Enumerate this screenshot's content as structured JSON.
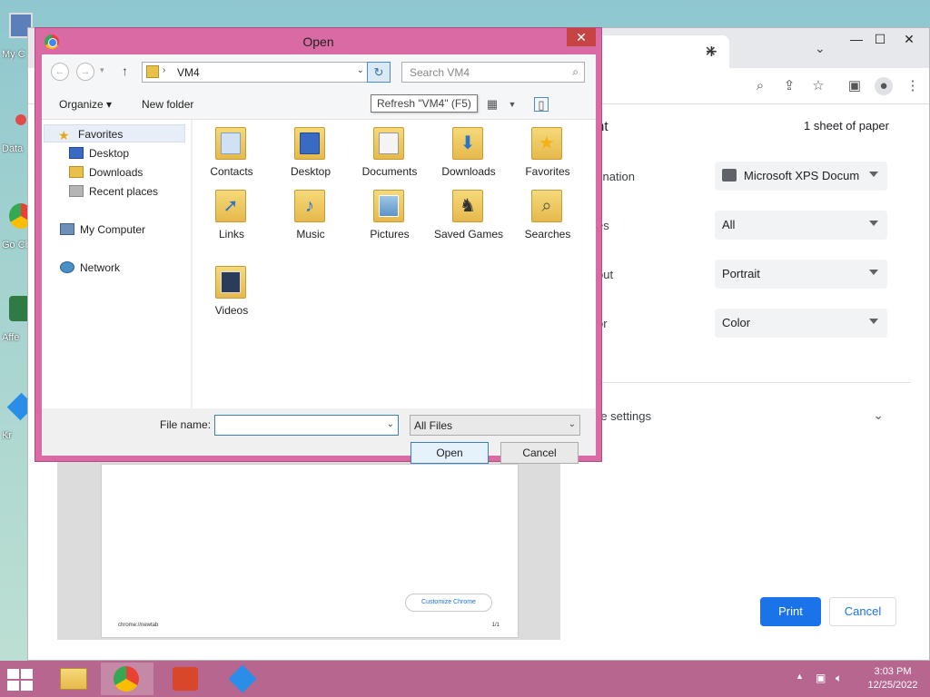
{
  "desktop": {
    "icons": [
      {
        "label": "My C"
      },
      {
        "label": "Data"
      },
      {
        "label": "Go Ch"
      },
      {
        "label": "Affe"
      },
      {
        "label": "Kr"
      }
    ]
  },
  "chrome": {
    "print_panel": {
      "title": "nt",
      "sheets": "1 sheet of paper",
      "rows": [
        {
          "label": "tination",
          "value": "Microsoft XPS Docum"
        },
        {
          "label": "es",
          "value": "All"
        },
        {
          "label": "out",
          "value": "Portrait"
        },
        {
          "label": "or",
          "value": "Color"
        }
      ],
      "more_settings": "re settings",
      "print_label": "Print",
      "cancel_label": "Cancel"
    },
    "preview": {
      "url": "chrome://newtab",
      "page_num": "1/1",
      "customize": "Customize Chrome"
    }
  },
  "dialog": {
    "title": "Open",
    "close": "✕",
    "path": "VM4",
    "search_placeholder": "Search VM4",
    "tooltip": "Refresh \"VM4\" (F5)",
    "organize": "Organize ▾",
    "new_folder": "New folder",
    "nav": {
      "favorites": "Favorites",
      "desktop": "Desktop",
      "downloads": "Downloads",
      "recent": "Recent places",
      "computer": "My Computer",
      "network": "Network"
    },
    "folders": [
      {
        "name": "Contacts"
      },
      {
        "name": "Desktop"
      },
      {
        "name": "Documents"
      },
      {
        "name": "Downloads"
      },
      {
        "name": "Favorites"
      },
      {
        "name": "Links"
      },
      {
        "name": "Music"
      },
      {
        "name": "Pictures"
      },
      {
        "name": "Saved Games"
      },
      {
        "name": "Searches"
      },
      {
        "name": "Videos"
      }
    ],
    "file_name_label": "File name:",
    "file_name_value": "",
    "filter": "All Files",
    "open_label": "Open",
    "cancel_label": "Cancel"
  },
  "taskbar": {
    "time": "3:03 PM",
    "date": "12/25/2022"
  },
  "colors": {
    "dialog_frame": "#d96aa4",
    "taskbar": "#b7678f",
    "accent_blue": "#1a73e8"
  }
}
